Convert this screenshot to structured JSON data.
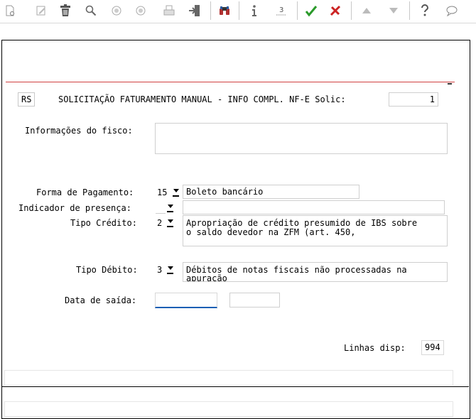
{
  "toolbar": {
    "icons": [
      "new-document-icon",
      "edit-icon",
      "delete-icon",
      "search-icon",
      "previous-icon",
      "next-icon",
      "print-icon",
      "exit-icon",
      "binoculars-icon",
      "info-icon",
      "number-icon",
      "confirm-icon",
      "cancel-icon",
      "up-icon",
      "down-icon",
      "help-icon",
      "comment-icon"
    ]
  },
  "header": {
    "company_code": "RS",
    "title": "SOLICITAÇÃO FATURAMENTO MANUAL - INFO COMPL. NF-E Solic:",
    "solic_value": "1"
  },
  "form": {
    "fisco_label": "Informações do fisco:",
    "fisco_value": "",
    "forma_pagamento_label": "Forma de Pagamento:",
    "forma_pagamento_code": "15",
    "forma_pagamento_desc": "Boleto bancário",
    "indicador_presenca_label": "Indicador de presença:",
    "indicador_presenca_code": "",
    "indicador_presenca_desc": "",
    "tipo_credito_label": "Tipo Crédito:",
    "tipo_credito_code": "2",
    "tipo_credito_desc": "Apropriação de crédito presumido de IBS sobre\no saldo devedor na ZFM (art. 450,",
    "tipo_debito_label": "Tipo Débito:",
    "tipo_debito_code": "3",
    "tipo_debito_desc": "Débitos de notas fiscais não processadas na\napuração",
    "data_saida_label": "Data de saída:",
    "data_saida_value": "",
    "data_saida_time": "",
    "linhas_label": "Linhas disp:",
    "linhas_value": "994"
  },
  "colors": {
    "red_line": "#d04040",
    "confirm": "#2a9a2a",
    "cancel": "#cc2222",
    "focus_underline": "#1a5fb4"
  }
}
